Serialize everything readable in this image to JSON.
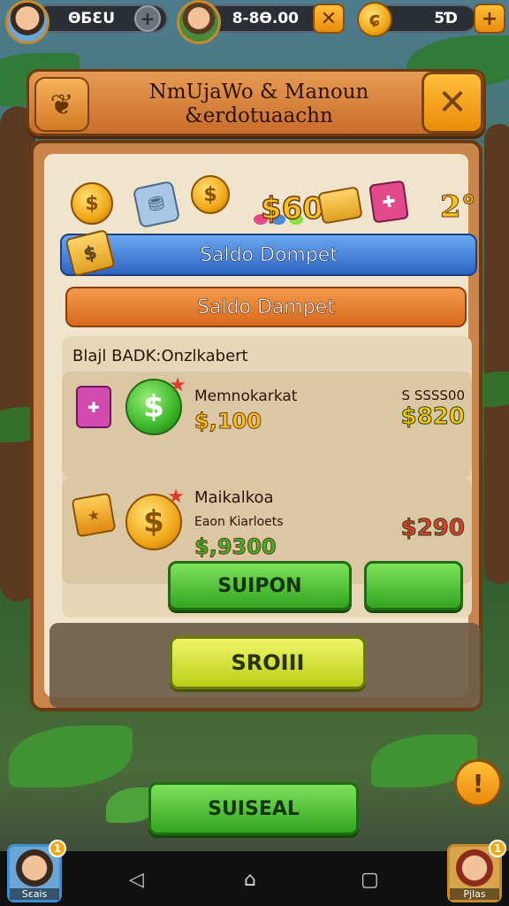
{
  "topbar": {
    "currency1": "ΘƂƐU",
    "currency2": "8-8Ɵ.00",
    "currency3": "5Ɗ",
    "plus_label": "+",
    "close_label": "✕"
  },
  "header": {
    "title_line1": "NmUjaWo & Manoun",
    "title_line2": "&erdotuaachn"
  },
  "shelf": {
    "amount": "$60",
    "extra": "2°"
  },
  "bars": {
    "blue_label": "Saldo Dompet",
    "orange_label": "Saldo Dampet"
  },
  "offers": {
    "title": "Blajl BADK:Onzlkabert",
    "items": [
      {
        "name": "Memnokarkat",
        "price": "$,100",
        "old": "S 𝖲𝖲𝖲𝖲𝟢𝟢",
        "new": "$820",
        "new_color": "#f7c21a"
      },
      {
        "name": "Maikalkoa",
        "subname": "Eaon Kiarloets",
        "price": "$,9300",
        "old": "",
        "new": "$290",
        "new_color": "#e23a2e"
      }
    ],
    "green_button": "SUIPON",
    "green_button2": ""
  },
  "actions": {
    "yellow_button": "SROIII",
    "bottom_button": "SUISEAL",
    "alert_label": "!"
  },
  "corners": {
    "left_label": "Sɛais",
    "right_label": "Pjlas",
    "notif": "1"
  },
  "navbar": {
    "back": "◁",
    "home": "⌂",
    "recent": "▢"
  }
}
